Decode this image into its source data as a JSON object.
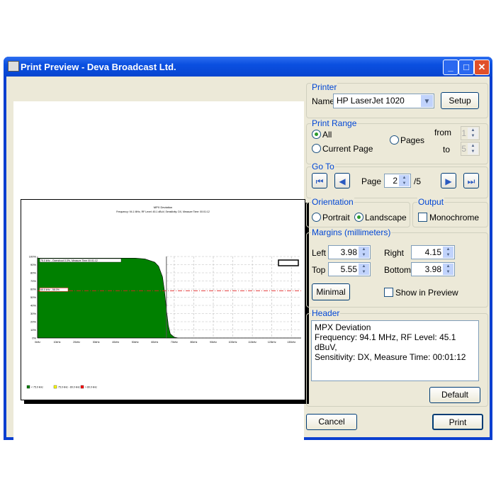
{
  "window": {
    "title": "Print Preview - Deva Broadcast Ltd.",
    "minimize": "_",
    "maximize": "□",
    "close": "✕"
  },
  "printer": {
    "group": "Printer",
    "name_label": "Name",
    "name_value": "HP LaserJet 1020",
    "setup": "Setup"
  },
  "print_range": {
    "group": "Print Range",
    "all": "All",
    "current_page": "Current Page",
    "pages": "Pages",
    "from_label": "from",
    "from_value": "1",
    "to_label": "to",
    "to_value": "5",
    "selected": "All"
  },
  "goto": {
    "group": "Go To",
    "page_label": "Page",
    "page_value": "2",
    "page_total": "/5"
  },
  "orientation": {
    "group": "Orientation",
    "portrait": "Portrait",
    "landscape": "Landscape",
    "selected": "Landscape"
  },
  "output": {
    "group": "Output",
    "monochrome": "Monochrome",
    "monochrome_checked": false
  },
  "margins": {
    "group": "Margins (millimeters)",
    "left_label": "Left",
    "left": "3.98",
    "right_label": "Right",
    "right": "4.15",
    "top_label": "Top",
    "top": "5.55",
    "bottom_label": "Bottom",
    "bottom": "3.98",
    "minimal": "Minimal",
    "show_in_preview": "Show in Preview",
    "show_checked": false
  },
  "header": {
    "group": "Header",
    "text": "MPX Deviation\nFrequency: 94.1 MHz, RF Level: 45.1 dBuV,\nSensitivity: DX, Measure Time: 00:01:12",
    "default": "Default"
  },
  "actions": {
    "cancel": "Cancel",
    "print": "Print"
  },
  "chart_data": {
    "type": "area",
    "title": "MPX Deviation",
    "subtitle": "Frequency: 94.1 MHz, RF Level: 45.1 dBuV, Sensitivity: DX, Measure Time: 00:01:12",
    "x_ticks": [
      "0kHz",
      "10kHz",
      "20kHz",
      "30kHz",
      "40kHz",
      "50kHz",
      "60kHz",
      "70kHz",
      "80kHz",
      "90kHz",
      "100kHz",
      "110kHz",
      "120kHz",
      "130kHz"
    ],
    "y_ticks": [
      "0%",
      "10%",
      "20%",
      "30%",
      "40%",
      "50%",
      "60%",
      "70%",
      "80%",
      "90%",
      "100%"
    ],
    "xlim": [
      0,
      135
    ],
    "ylim": [
      0,
      100
    ],
    "series": [
      {
        "x": [
          0,
          50,
          55,
          60,
          62,
          64,
          65,
          66,
          67,
          68,
          70,
          72,
          135
        ],
        "y": [
          98,
          98,
          97,
          93,
          88,
          75,
          58,
          35,
          15,
          5,
          1,
          0,
          0
        ],
        "color": "#008000"
      }
    ],
    "annotations": [
      "75.0 kHz - Overshoot 0.0%, Measure Time 00:01:12",
      "65.0 kHz - 58.0%"
    ],
    "marker_x": 66,
    "reference_y": 58,
    "legend": [
      {
        "label": "< 75.0 kHz",
        "color": "#008000"
      },
      {
        "label": "75.0 kHz - 80.0 kHz",
        "color": "#ffff00"
      },
      {
        "label": "> 80.0 kHz",
        "color": "#ff0000"
      }
    ],
    "grid": true
  }
}
